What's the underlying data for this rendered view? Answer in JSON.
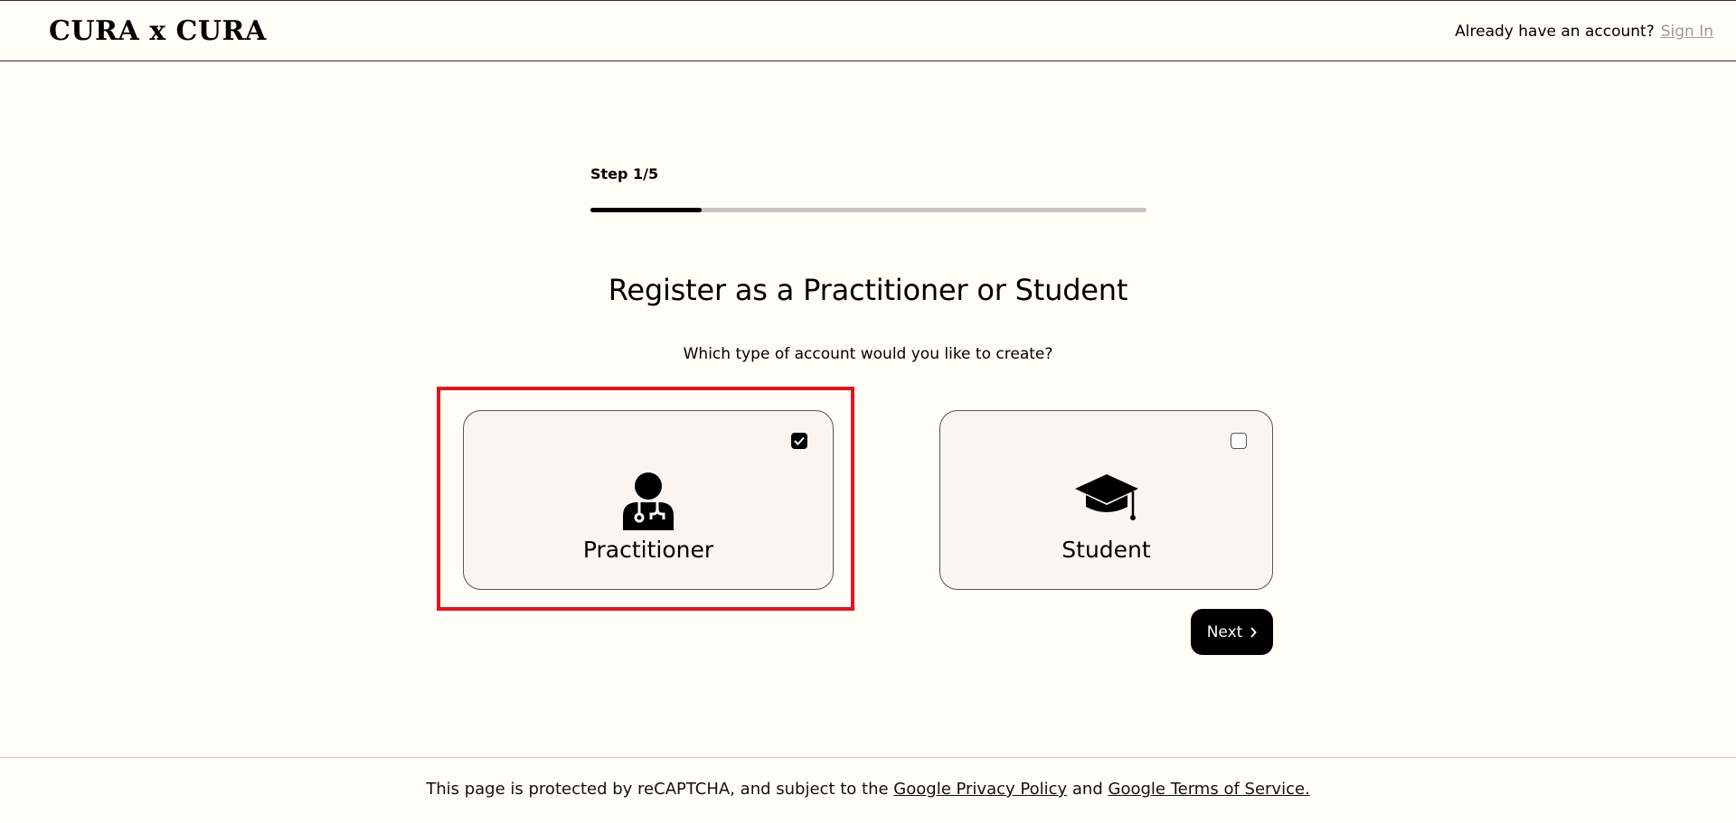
{
  "header": {
    "logo": "CURA x CURA",
    "account_prompt": "Already have an account?",
    "sign_in": "Sign In"
  },
  "step": {
    "label": "Step 1/5",
    "progress": 0.2
  },
  "main": {
    "title": "Register as a Practitioner or Student",
    "subtitle": "Which type of account would you like to create?",
    "options": [
      {
        "label": "Practitioner",
        "icon": "doctor-icon",
        "checked": true
      },
      {
        "label": "Student",
        "icon": "graduation-cap-icon",
        "checked": false
      }
    ],
    "next_label": "Next"
  },
  "footer": {
    "text_before": "This page is protected by reCAPTCHA, and subject to the",
    "privacy_link": "Google Privacy Policy",
    "and": "and",
    "terms_link": "Google Terms of Service."
  },
  "colors": {
    "background": "#fffdf6",
    "card_background": "#faf5f0",
    "highlight": "#e0161c",
    "muted_link": "#9e9a93"
  }
}
